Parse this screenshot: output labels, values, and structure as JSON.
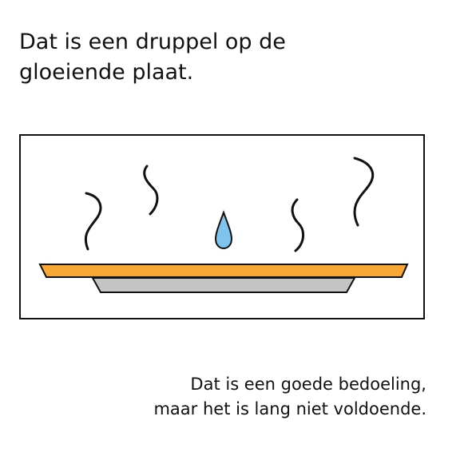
{
  "heading": {
    "line1": "Dat is een druppel op de",
    "line2": "gloeiende plaat."
  },
  "caption": {
    "line1": "Dat is een goede bedoeling,",
    "line2": "maar het is lang niet voldoende."
  },
  "colors": {
    "hotplate_top": "#F7A733",
    "hotplate_base": "#C4C4C4",
    "droplet": "#7EC4EC",
    "outline": "#111111",
    "background": "#FFFFFF"
  },
  "icons": [
    "steam-icon",
    "water-drop-icon",
    "hotplate-icon"
  ]
}
